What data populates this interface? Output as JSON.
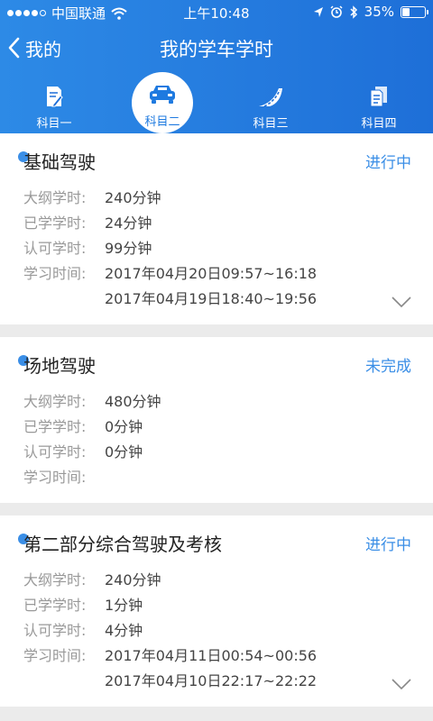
{
  "status_bar": {
    "carrier": "中国联通",
    "time": "上午10:48",
    "battery": "35%",
    "battery_level": 0.35
  },
  "nav": {
    "back_label": "我的",
    "title": "我的学车学时"
  },
  "tabs": [
    {
      "label": "科目一",
      "icon": "document-pen-icon"
    },
    {
      "label": "科目二",
      "icon": "car-icon",
      "active": true
    },
    {
      "label": "科目三",
      "icon": "road-icon"
    },
    {
      "label": "科目四",
      "icon": "documents-icon"
    }
  ],
  "labels": {
    "outline": "大纲学时:",
    "learned": "已学学时:",
    "approved": "认可学时:",
    "study_time": "学习时间:"
  },
  "cards": [
    {
      "title": "基础驾驶",
      "status": "进行中",
      "outline": "240分钟",
      "learned": "24分钟",
      "approved": "99分钟",
      "times": [
        "2017年04月20日09:57~16:18",
        "2017年04月19日18:40~19:56"
      ]
    },
    {
      "title": "场地驾驶",
      "status": "未完成",
      "outline": "480分钟",
      "learned": "0分钟",
      "approved": "0分钟",
      "times": []
    },
    {
      "title": "第二部分综合驾驶及考核",
      "status": "进行中",
      "outline": "240分钟",
      "learned": "1分钟",
      "approved": "4分钟",
      "times": [
        "2017年04月11日00:54~00:56",
        "2017年04月10日22:17~22:22"
      ]
    }
  ],
  "colors": {
    "header": "#1e6fd8",
    "accent": "#3a8ee6",
    "background": "#ebebeb"
  }
}
